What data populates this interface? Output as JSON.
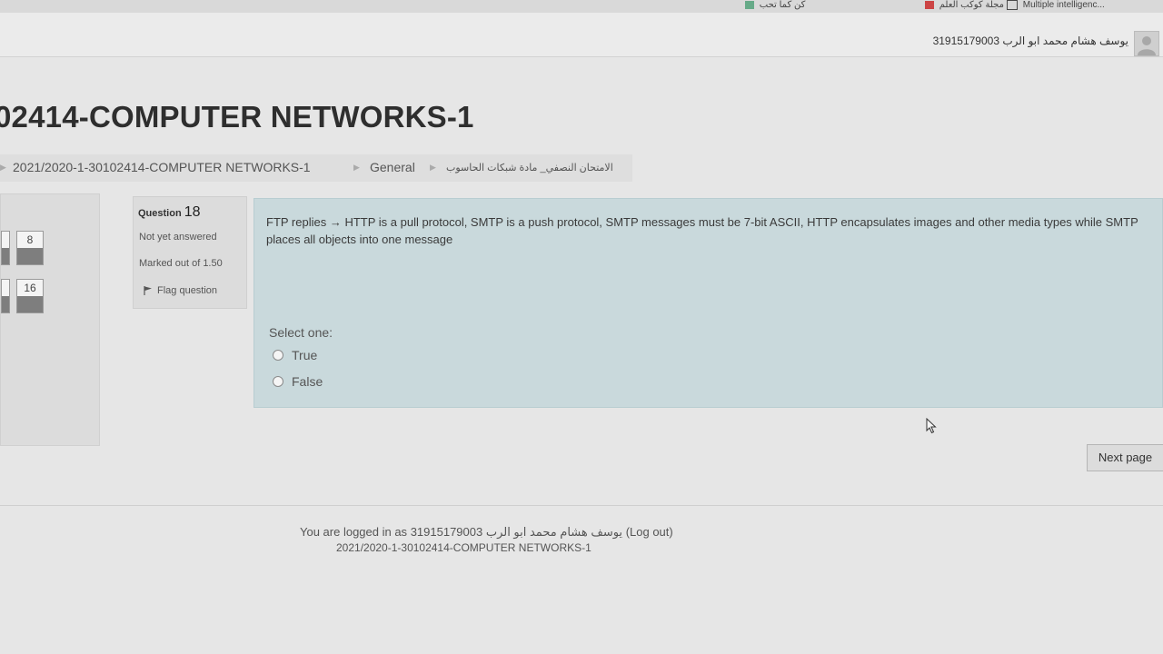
{
  "bookmarks": [
    {
      "label": "Multiple intelligenc..."
    },
    {
      "label": "مجلة كوكب العلم"
    },
    {
      "label": "كن كما تحب"
    }
  ],
  "user": {
    "name": "يوسف هشام محمد ابو الرب 31915179003"
  },
  "course": {
    "title": "02414-COMPUTER NETWORKS-1"
  },
  "breadcrumb": [
    "2021/2020-1-30102414-COMPUTER NETWORKS-1",
    "General",
    "الامتحان النصفي_ مادة شبكات الحاسوب"
  ],
  "quiz_nav": {
    "buttons": [
      "8",
      "16"
    ]
  },
  "question": {
    "label": "Question",
    "number": "18",
    "state": "Not yet answered",
    "grade": "Marked out of 1.50",
    "flag_label": "Flag question",
    "text": "FTP replies → HTTP is a pull protocol, SMTP is a push protocol, SMTP messages must be 7-bit ASCII, HTTP encapsulates images and other media types while SMTP places all objects into one message",
    "prompt": "Select one:",
    "options": [
      "True",
      "False"
    ]
  },
  "actions": {
    "next_page": "Next page"
  },
  "footer": {
    "logged_in_prefix": "You are logged in as",
    "user": "يوسف هشام محمد ابو الرب 31915179003",
    "logout": "(Log out)",
    "course_link": "2021/2020-1-30102414-COMPUTER NETWORKS-1"
  },
  "colors": {
    "content_bg": "#c9d9dc",
    "page_bg": "#e6e6e6",
    "nav_bar": "#7e7e7e"
  }
}
